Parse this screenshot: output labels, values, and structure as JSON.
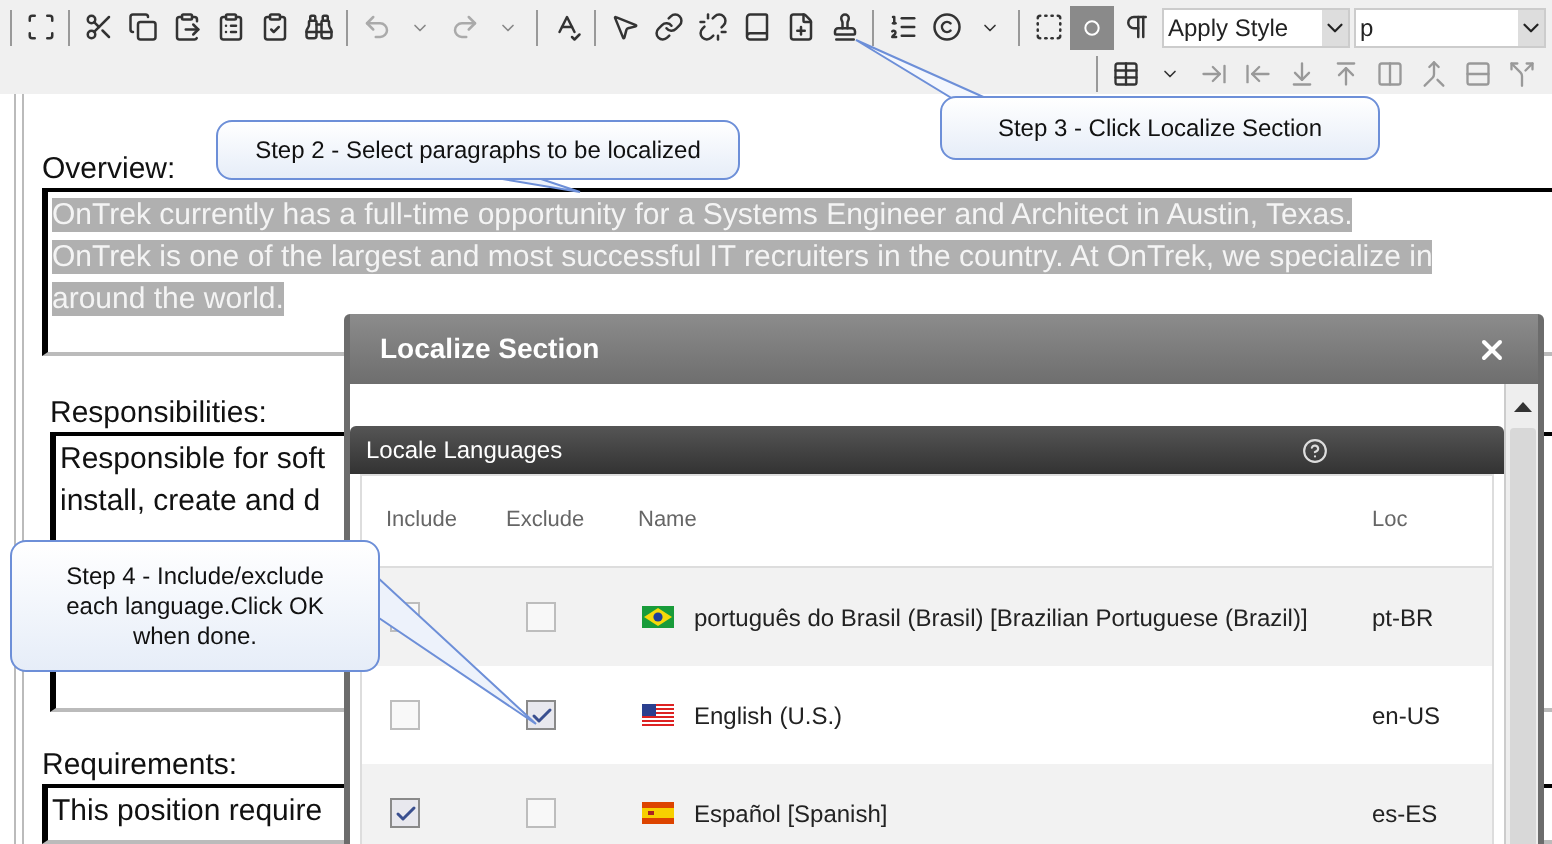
{
  "toolbar": {
    "style_dropdown": {
      "value": "Apply Style"
    },
    "format_field": {
      "value": "p"
    }
  },
  "editor": {
    "sections": [
      {
        "label": "Overview:",
        "selected": true,
        "lines": [
          "OnTrek currently has a full-time opportunity for a Systems Engineer and Architect in Austin, Texas.",
          "OnTrek is one of the largest and most successful IT recruiters in the country. At OnTrek, we specialize in",
          "around the world."
        ]
      },
      {
        "label": "Responsibilities:",
        "selected": false,
        "lines": [
          "Responsible for soft",
          "install, create and d"
        ]
      },
      {
        "label": "Requirements:",
        "selected": false,
        "lines": [
          "This position require"
        ]
      }
    ]
  },
  "dialog": {
    "title": "Localize Section",
    "panel": {
      "title": "Locale Languages",
      "columns": [
        "Include",
        "Exclude",
        "Name",
        "Loc"
      ],
      "rows": [
        {
          "kind": "br",
          "name": "português do Brasil (Brasil) [Brazilian Portuguese (Brazil)]",
          "loc": "pt-BR",
          "include": false,
          "exclude": false
        },
        {
          "kind": "us",
          "name": "English (U.S.)",
          "loc": "en-US",
          "include": false,
          "exclude": true
        },
        {
          "kind": "es",
          "name": "Español [Spanish]",
          "loc": "es-ES",
          "include": true,
          "exclude": false
        }
      ]
    }
  },
  "callouts": [
    {
      "text": "Step 2 - Select paragraphs to be localized"
    },
    {
      "text": "Step 3 - Click Localize Section"
    },
    {
      "text": "Step 4 - Include/exclude each language.Click OK when done."
    }
  ]
}
